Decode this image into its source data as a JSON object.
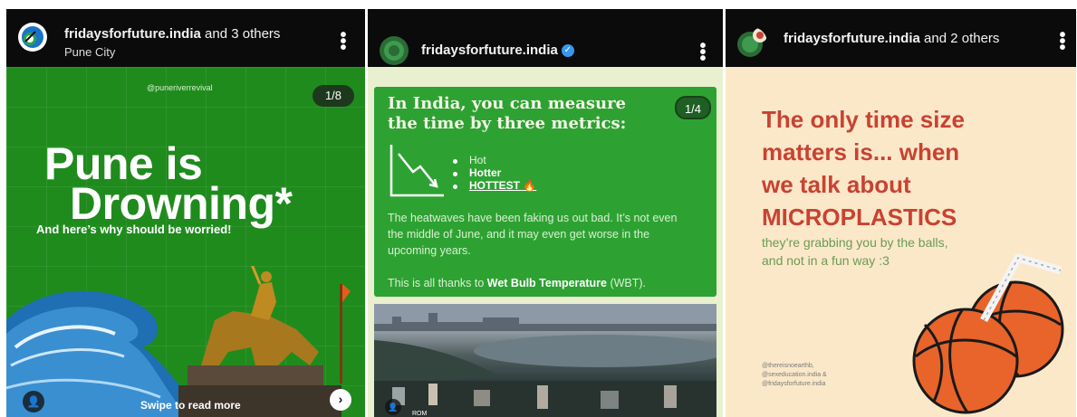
{
  "posts": [
    {
      "username": "fridaysforfuture.india",
      "collab_suffix": " and 3 others",
      "location": "Pune City",
      "slide": {
        "handle": "@puneriverrevival",
        "counter": "1/8",
        "title_line1": "Pune is",
        "title_line2": "Drowning*",
        "subtitle": "And here’s why should be worried!",
        "swipe_text": "Swipe to read more"
      },
      "icons": [
        "more-vertical-icon",
        "user-tag-icon",
        "next-arrow-icon"
      ]
    },
    {
      "username": "fridaysforfuture.india",
      "verified": true,
      "slide": {
        "counter": "1/4",
        "heading": "In India, you can measure the time by three metrics:",
        "metrics": [
          "Hot",
          "Hotter",
          "HOTTEST"
        ],
        "metric_emoji": "🔥",
        "paragraph": "The heatwaves have been faking us out bad. It’s not even the middle of June, and it may even get worse in the upcoming years.",
        "wbt_prefix": "This is all thanks to ",
        "wbt_bold": "Wet Bulb Temperature",
        "wbt_suffix": " (WBT).",
        "photo_credit": "ROM"
      }
    },
    {
      "username": "fridaysforfuture.india",
      "collab_suffix": " and 2 others",
      "slide": {
        "title_lines": [
          "The only time size",
          "matters is... when",
          "we talk about",
          "MICROPLASTICS"
        ],
        "subtitle": "they’re grabbing you by the balls, and not in a fun way :3",
        "credits": [
          "@thereisnoearthb,",
          "@sexeducation.india &",
          "@fridaysforfuture.india"
        ]
      }
    }
  ],
  "colors": {
    "header_bg": "#0b0b0b",
    "pune_green": "#1f8b1d",
    "card_green": "#2da232",
    "micro_red": "#c84232",
    "micro_green": "#6d9a56"
  }
}
